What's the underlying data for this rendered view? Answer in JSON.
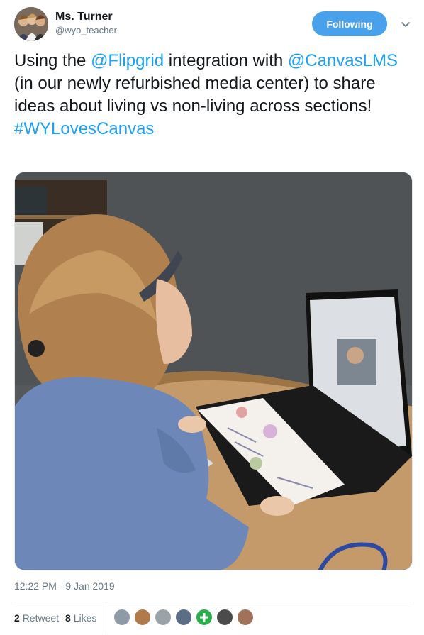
{
  "author": {
    "display_name": "Ms. Turner",
    "handle": "@wyo_teacher"
  },
  "follow_button": {
    "label": "Following"
  },
  "tweet": {
    "text_parts": [
      {
        "text": "Using the ",
        "link": false
      },
      {
        "text": "@Flipgrid",
        "link": true
      },
      {
        "text": " integration with ",
        "link": false
      },
      {
        "text": "@CanvasLMS",
        "link": true
      },
      {
        "text": " (in our newly refurbished media center) to share ideas about living vs non-living across sections! ",
        "link": false
      },
      {
        "text": "#WYLovesCanvas",
        "link": true
      }
    ],
    "timestamp": "12:22 PM - 9 Jan 2019"
  },
  "stats": {
    "retweets_count": "2",
    "retweets_label": "Retweet",
    "likes_count": "8",
    "likes_label": "Likes"
  },
  "colors": {
    "link": "#1da1f2",
    "follow_button_bg": "#4aa1eb",
    "secondary_text": "#657786"
  },
  "icons": {
    "chevron": "chevron-down-icon"
  }
}
